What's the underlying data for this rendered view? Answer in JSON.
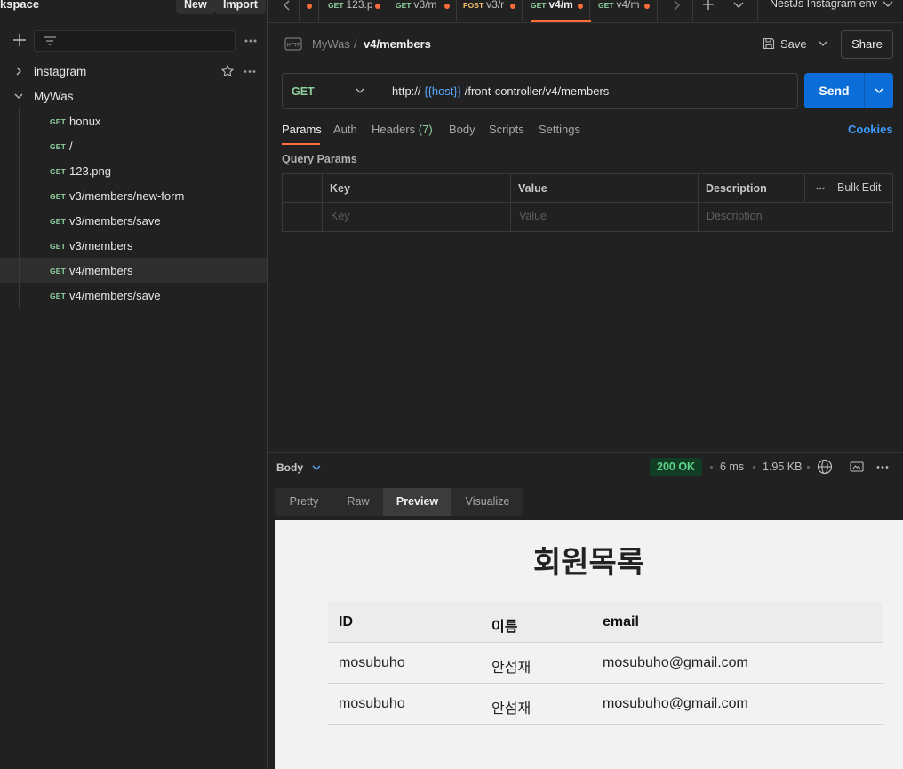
{
  "sidebar": {
    "workspace_title": "kspace",
    "new_label": "New",
    "import_label": "Import",
    "collections": [
      {
        "name": "instagram",
        "expanded": false
      },
      {
        "name": "MyWas",
        "expanded": true
      }
    ],
    "requests": [
      {
        "method": "GET",
        "name": "honux"
      },
      {
        "method": "GET",
        "name": "/"
      },
      {
        "method": "GET",
        "name": "123.png"
      },
      {
        "method": "GET",
        "name": "v3/members/new-form"
      },
      {
        "method": "GET",
        "name": "v3/members/save"
      },
      {
        "method": "GET",
        "name": "v3/members"
      },
      {
        "method": "GET",
        "name": "v4/members"
      },
      {
        "method": "GET",
        "name": "v4/members/save"
      }
    ]
  },
  "tabs": [
    {
      "method": "GET",
      "name": "123.p"
    },
    {
      "method": "GET",
      "name": "v3/m"
    },
    {
      "method": "POST",
      "name": "v3/r"
    },
    {
      "method": "GET",
      "name": "v4/m"
    },
    {
      "method": "GET",
      "name": "v4/m"
    }
  ],
  "environment": "NestJs Instagram env",
  "request": {
    "breadcrumb_parent": "MyWas",
    "breadcrumb_sep": "/",
    "breadcrumb_current": "v4/members",
    "save_label": "Save",
    "share_label": "Share",
    "method": "GET",
    "url_prefix": "http://",
    "url_var": "{{host}}",
    "url_path": "/front-controller/v4/members",
    "send_label": "Send",
    "tabs": {
      "params": "Params",
      "auth": "Auth",
      "headers": "Headers",
      "headers_count": "(7)",
      "body": "Body",
      "scripts": "Scripts",
      "settings": "Settings",
      "cookies": "Cookies"
    },
    "query_params_title": "Query Params",
    "columns": {
      "key": "Key",
      "value": "Value",
      "description": "Description",
      "bulk_edit": "Bulk Edit"
    },
    "placeholders": {
      "key": "Key",
      "value": "Value",
      "description": "Description"
    }
  },
  "response": {
    "body_label": "Body",
    "status": "200 OK",
    "time": "6 ms",
    "size": "1.95 KB",
    "view_tabs": [
      "Pretty",
      "Raw",
      "Preview",
      "Visualize"
    ],
    "active_view": "Preview",
    "preview": {
      "heading": "회원목록",
      "headers": [
        "ID",
        "이름",
        "email"
      ],
      "rows": [
        [
          "mosubuho",
          "안섬재",
          "mosubuho@gmail.com"
        ],
        [
          "mosubuho",
          "안섬재",
          "mosubuho@gmail.com"
        ]
      ]
    }
  },
  "colors": {
    "accent": "#ff6c37",
    "send": "#0b6dd8",
    "get_method": "#8fd19e",
    "post_method": "#f5c26b",
    "status_ok": "#5fd38a",
    "link": "#3d9bff"
  }
}
